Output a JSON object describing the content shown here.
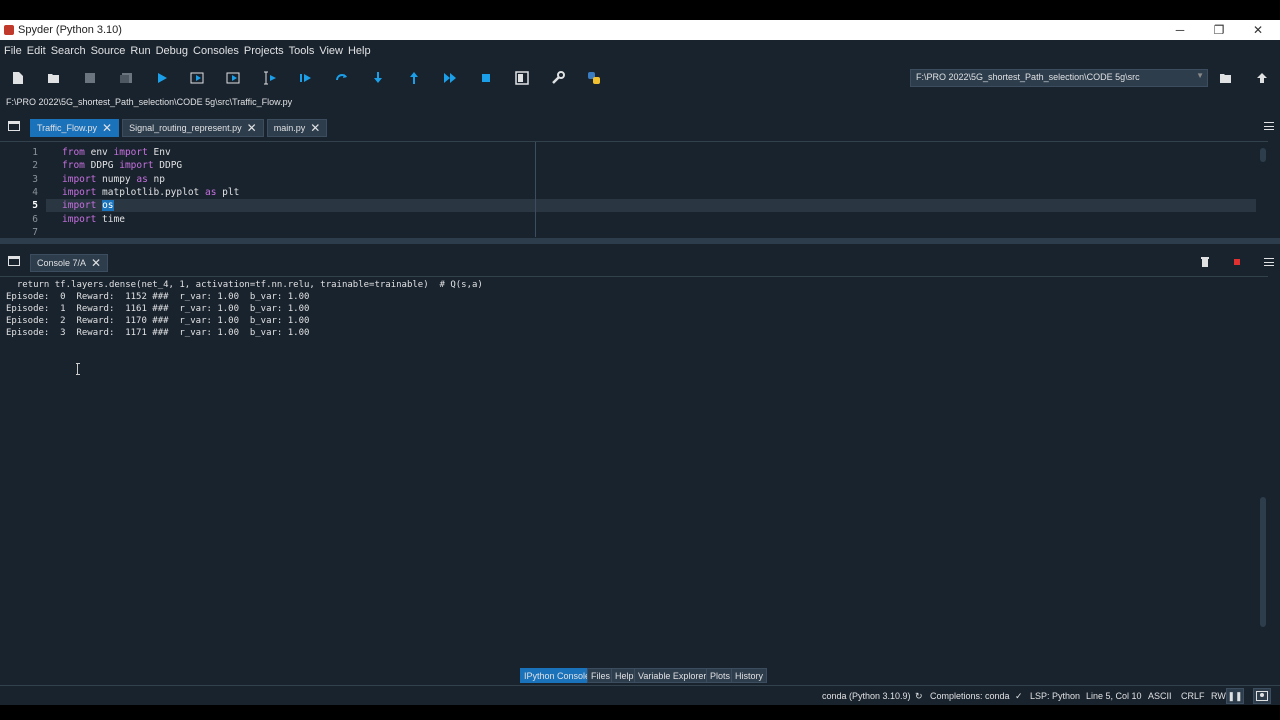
{
  "window": {
    "title": "Spyder (Python 3.10)",
    "minimize": "─",
    "restore": "❐",
    "close": "✕"
  },
  "menu": [
    "File",
    "Edit",
    "Search",
    "Source",
    "Run",
    "Debug",
    "Consoles",
    "Projects",
    "Tools",
    "View",
    "Help"
  ],
  "toolbar": {
    "working_dir": "F:\\PRO 2022\\5G_shortest_Path_selection\\CODE 5g\\src",
    "icons": [
      "new-file-icon",
      "open-file-icon",
      "save-icon",
      "save-all-icon",
      "run-icon",
      "run-cell-icon",
      "run-cell-advance-icon",
      "run-selection-icon",
      "debug-icon",
      "debug-step-icon",
      "debug-step-into-icon",
      "debug-step-return-icon",
      "debug-continue-icon",
      "debug-stop-icon",
      "maximize-pane-icon",
      "preferences-icon",
      "python-path-icon"
    ],
    "colors": {
      "accent": "#1a72bb",
      "run": "#1a9fe8",
      "stop": "#1a9fe8",
      "wrench": "#e0e1e3",
      "python": "#f0c030"
    }
  },
  "editor": {
    "file_path": "F:\\PRO 2022\\5G_shortest_Path_selection\\CODE 5g\\src\\Traffic_Flow.py",
    "tabs": [
      {
        "label": "Traffic_Flow.py",
        "close": "✕"
      },
      {
        "label": "Signal_routing_represent.py",
        "close": "✕"
      },
      {
        "label": "main.py",
        "close": "✕"
      }
    ],
    "line_numbers": [
      "1",
      "2",
      "3",
      "4",
      "5",
      "6",
      "7"
    ],
    "lines": [
      {
        "kw1": "from",
        "a": " env ",
        "kw2": "import",
        "b": " Env"
      },
      {
        "kw1": "from",
        "a": " DDPG ",
        "kw2": "import",
        "b": " DDPG"
      },
      {
        "kw1": "import",
        "a": " numpy ",
        "kw2": "as",
        "b": " np"
      },
      {
        "kw1": "import",
        "a": " matplotlib.pyplot ",
        "kw2": "as",
        "b": " plt"
      },
      {
        "kw1": "import",
        "a": " ",
        "sel": "os"
      },
      {
        "kw1": "import",
        "a": " time"
      },
      {
        "kw1": "",
        "a": ""
      }
    ]
  },
  "console": {
    "tab_label": "Console 7/A",
    "tab_close": "✕",
    "lines": [
      "  return tf.layers.dense(net_4, 1, activation=tf.nn.relu, trainable=trainable)  # Q(s,a)",
      "Episode:  0  Reward:  1152 ###  r_var: 1.00  b_var: 1.00",
      "Episode:  1  Reward:  1161 ###  r_var: 1.00  b_var: 1.00",
      "Episode:  2  Reward:  1170 ###  r_var: 1.00  b_var: 1.00",
      "Episode:  3  Reward:  1171 ###  r_var: 1.00  b_var: 1.00"
    ]
  },
  "dock_tabs": [
    "IPython Console",
    "Files",
    "Help",
    "Variable Explorer",
    "Plots",
    "History"
  ],
  "status": {
    "env": "conda (Python 3.10.9)",
    "completions": "Completions: conda",
    "lsp": "LSP: Python",
    "position": "Line 5, Col 10",
    "encoding": "ASCII",
    "eol": "CRLF",
    "perm": "RW"
  }
}
